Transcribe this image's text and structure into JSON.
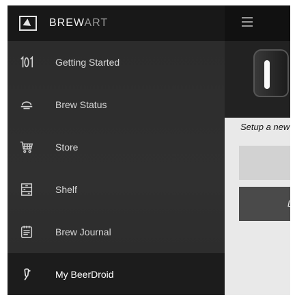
{
  "app": {
    "brand_bold": "BREW",
    "brand_light": "ART"
  },
  "menu": {
    "items": [
      {
        "label": "Getting Started",
        "icon": "101-icon",
        "active": false
      },
      {
        "label": "Brew Status",
        "icon": "brew-status-icon",
        "active": false
      },
      {
        "label": "Store",
        "icon": "cart-icon",
        "active": false
      },
      {
        "label": "Shelf",
        "icon": "shelf-icon",
        "active": false
      },
      {
        "label": "Brew Journal",
        "icon": "journal-icon",
        "active": false
      },
      {
        "label": "My BeerDroid",
        "icon": "beerdroid-icon",
        "active": true
      }
    ]
  },
  "main": {
    "setup_text": "Setup a new",
    "button_label": "LIN"
  }
}
